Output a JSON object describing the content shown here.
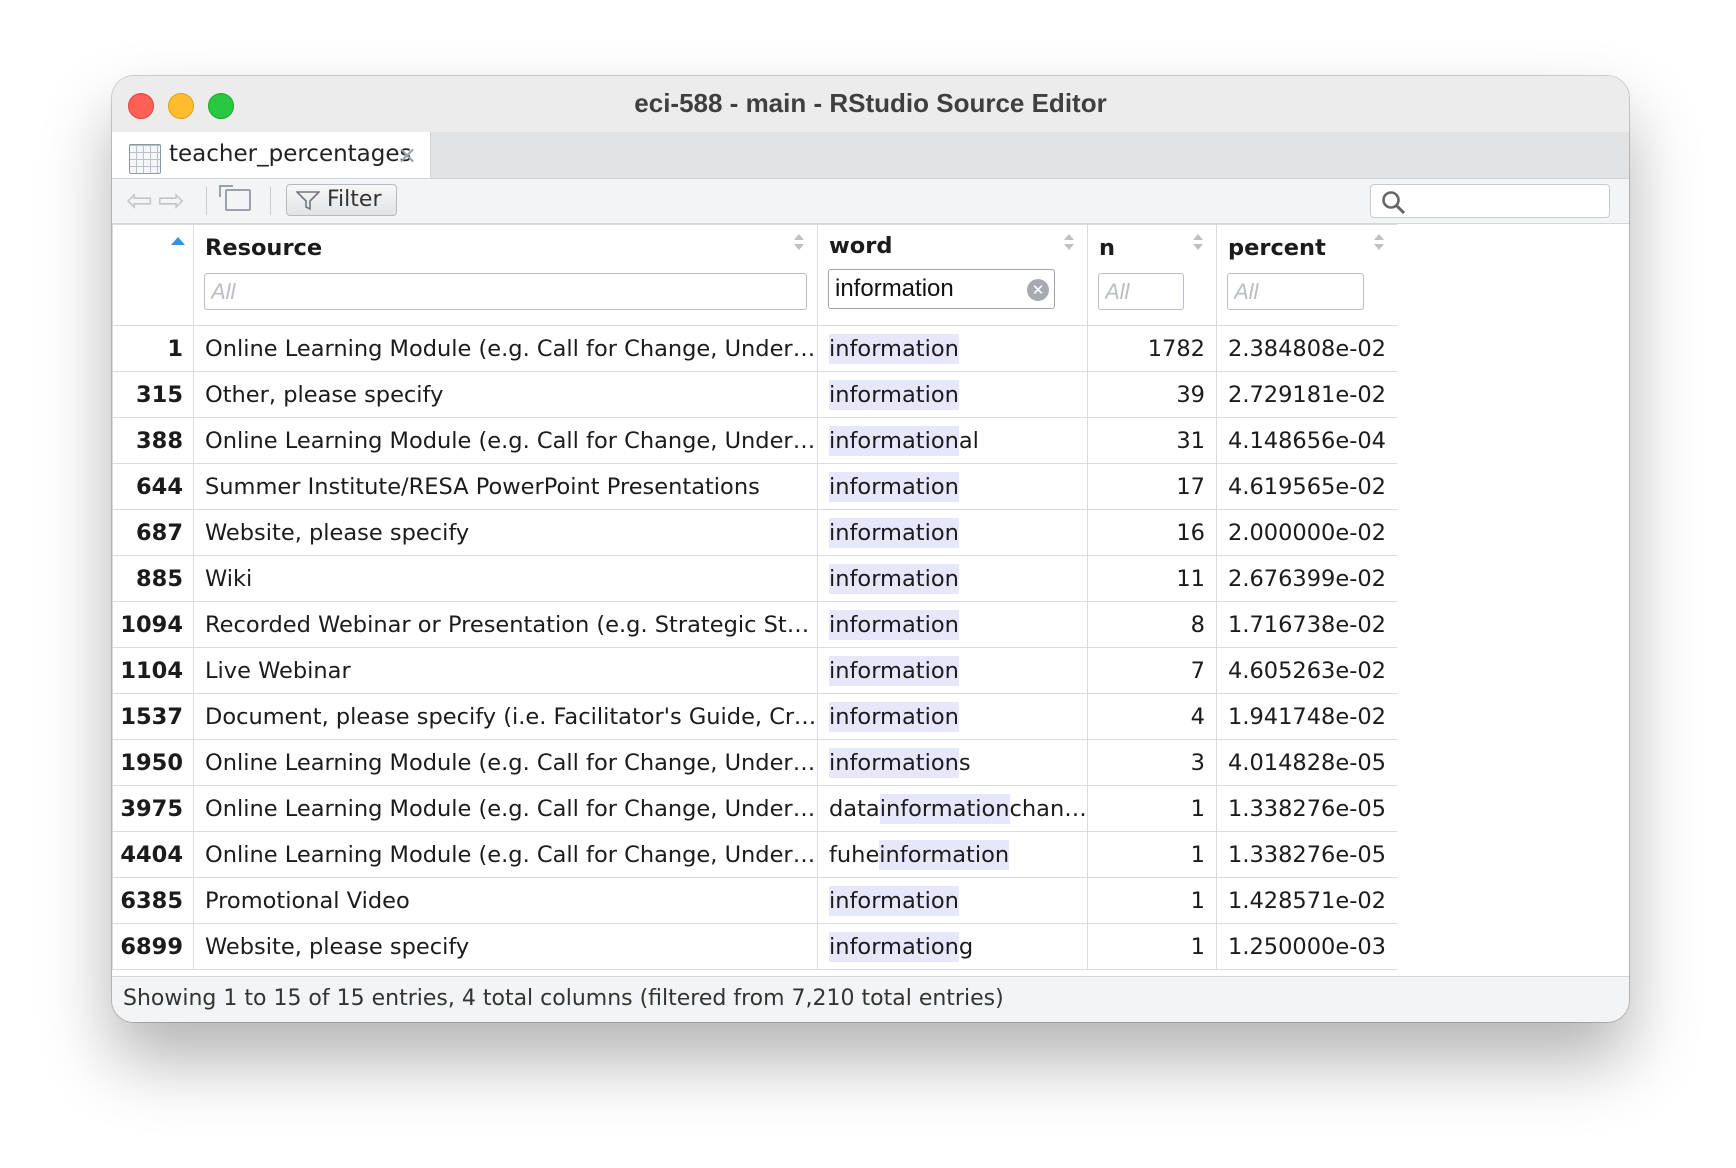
{
  "window": {
    "title": "eci-588 - main - RStudio Source Editor"
  },
  "tab": {
    "label": "teacher_percentages",
    "close_symbol": "×",
    "icon": "table-icon"
  },
  "toolbar": {
    "back_symbol": "⇦",
    "forward_symbol": "⇨",
    "filter_label": "Filter",
    "search_value": ""
  },
  "table": {
    "columns": [
      {
        "label": "Resource",
        "filter_value": "",
        "filter_placeholder": "All"
      },
      {
        "label": "word",
        "filter_value": "information",
        "filter_placeholder": ""
      },
      {
        "label": "n",
        "filter_value": "",
        "filter_placeholder": "All"
      },
      {
        "label": "percent",
        "filter_value": "",
        "filter_placeholder": "All"
      }
    ],
    "highlight_color": "#e7e7fb",
    "rows": [
      {
        "idx": "1",
        "resource": "Online Learning Module (e.g. Call for Change, Understanding the Formative Process)",
        "word_pre": "",
        "word_hit": "information",
        "word_post": "",
        "n": "1782",
        "percent": "2.384808e-02"
      },
      {
        "idx": "315",
        "resource": "Other, please specify",
        "word_pre": "",
        "word_hit": "information",
        "word_post": "",
        "n": "39",
        "percent": "2.729181e-02"
      },
      {
        "idx": "388",
        "resource": "Online Learning Module (e.g. Call for Change, Understanding the Formative Process)",
        "word_pre": "",
        "word_hit": "information",
        "word_post": "al",
        "n": "31",
        "percent": "4.148656e-04"
      },
      {
        "idx": "644",
        "resource": "Summer Institute/RESA PowerPoint Presentations",
        "word_pre": "",
        "word_hit": "information",
        "word_post": "",
        "n": "17",
        "percent": "4.619565e-02"
      },
      {
        "idx": "687",
        "resource": "Website, please specify",
        "word_pre": "",
        "word_hit": "information",
        "word_post": "",
        "n": "16",
        "percent": "2.000000e-02"
      },
      {
        "idx": "885",
        "resource": "Wiki",
        "word_pre": "",
        "word_hit": "information",
        "word_post": "",
        "n": "11",
        "percent": "2.676399e-02"
      },
      {
        "idx": "1094",
        "resource": "Recorded Webinar or Presentation (e.g. Strategic Staffing Webinar)",
        "word_pre": "",
        "word_hit": "information",
        "word_post": "",
        "n": "8",
        "percent": "1.716738e-02"
      },
      {
        "idx": "1104",
        "resource": "Live Webinar",
        "word_pre": "",
        "word_hit": "information",
        "word_post": "",
        "n": "7",
        "percent": "4.605263e-02"
      },
      {
        "idx": "1537",
        "resource": "Document, please specify (i.e. Facilitator's Guide, Crosswalk)",
        "word_pre": "",
        "word_hit": "information",
        "word_post": "",
        "n": "4",
        "percent": "1.941748e-02"
      },
      {
        "idx": "1950",
        "resource": "Online Learning Module (e.g. Call for Change, Understanding the Formative Process)",
        "word_pre": "",
        "word_hit": "information",
        "word_post": "s",
        "n": "3",
        "percent": "4.014828e-05"
      },
      {
        "idx": "3975",
        "resource": "Online Learning Module (e.g. Call for Change, Understanding the Formative Process)",
        "word_pre": "data",
        "word_hit": "information",
        "word_post": "change",
        "n": "1",
        "percent": "1.338276e-05"
      },
      {
        "idx": "4404",
        "resource": "Online Learning Module (e.g. Call for Change, Understanding the Formative Process)",
        "word_pre": "fuhe",
        "word_hit": "information",
        "word_post": "",
        "n": "1",
        "percent": "1.338276e-05"
      },
      {
        "idx": "6385",
        "resource": "Promotional Video",
        "word_pre": "",
        "word_hit": "information",
        "word_post": "",
        "n": "1",
        "percent": "1.428571e-02"
      },
      {
        "idx": "6899",
        "resource": "Website, please specify",
        "word_pre": "",
        "word_hit": "information",
        "word_post": "g",
        "n": "1",
        "percent": "1.250000e-03"
      }
    ]
  },
  "status": {
    "text": "Showing 1 to 15 of 15 entries, 4 total columns (filtered from 7,210 total entries)"
  }
}
